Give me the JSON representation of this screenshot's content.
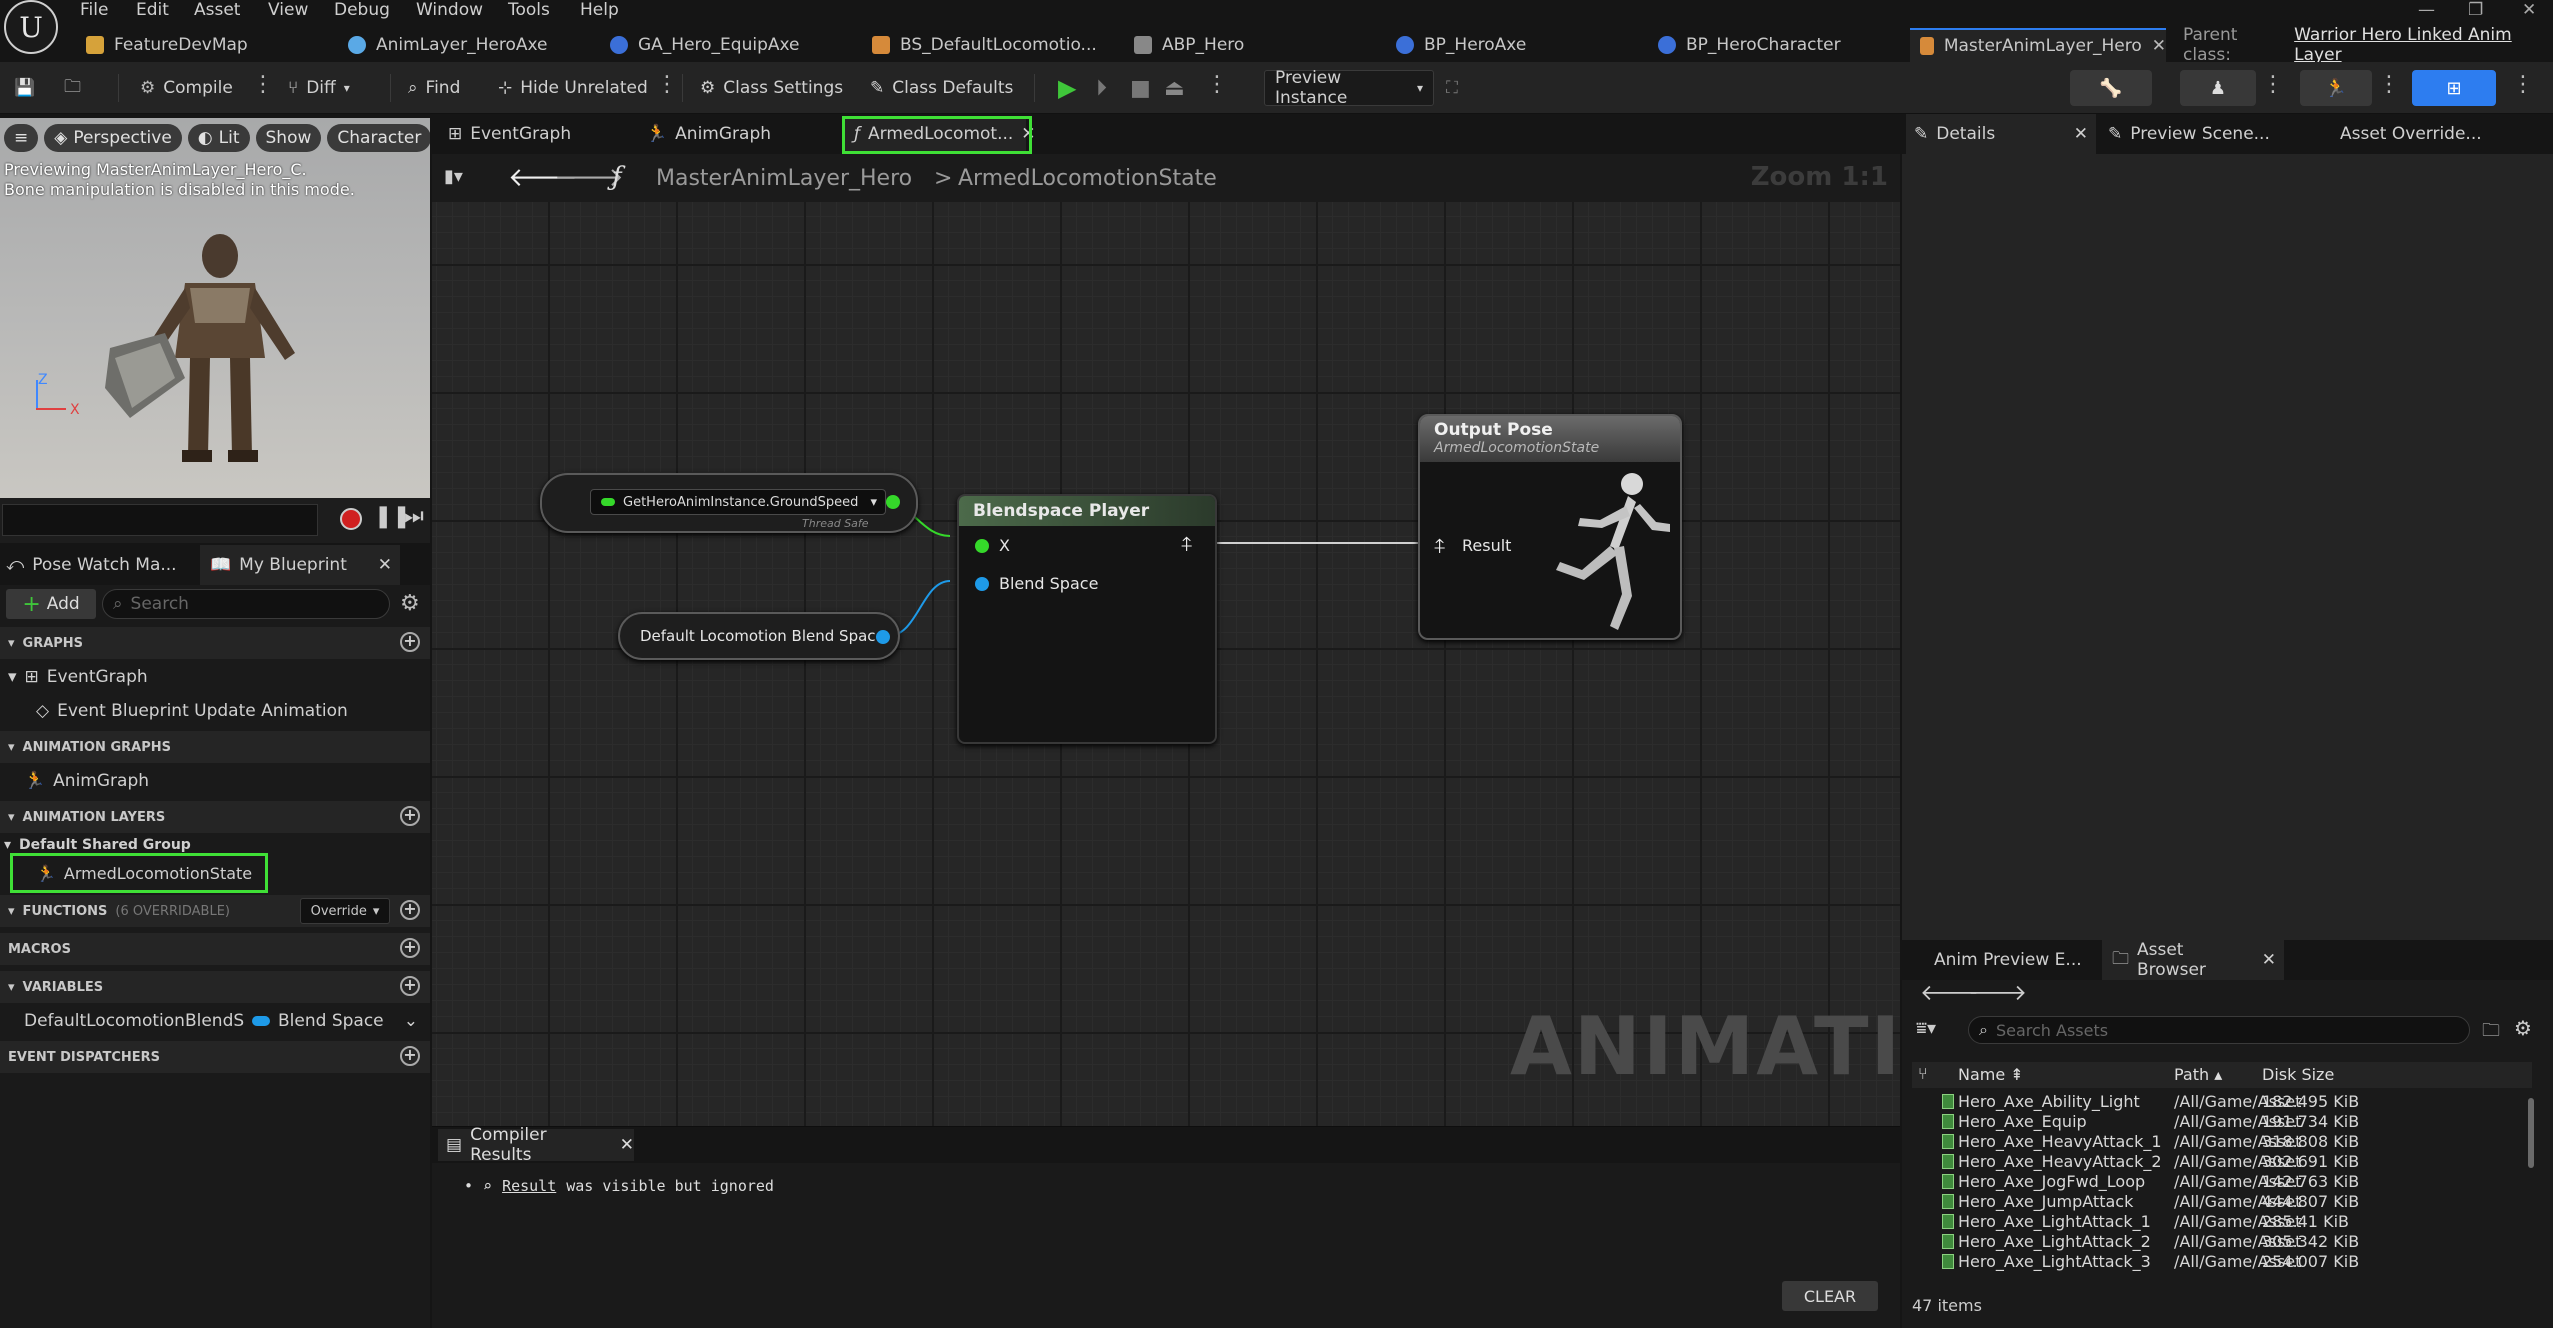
{
  "menu": {
    "items": [
      "File",
      "Edit",
      "Asset",
      "View",
      "Debug",
      "Window",
      "Tools",
      "Help"
    ]
  },
  "doc_tabs": [
    {
      "label": "FeatureDevMap",
      "color": "#d6a23a"
    },
    {
      "label": "AnimLayer_HeroAxe",
      "color": "#5aa9e6"
    },
    {
      "label": "GA_Hero_EquipAxe",
      "color": "#3b6fd8"
    },
    {
      "label": "BS_DefaultLocomotio...",
      "color": "#d68a3a"
    },
    {
      "label": "ABP_Hero",
      "color": "#d0d0d0"
    },
    {
      "label": "BP_HeroAxe",
      "color": "#3b6fd8"
    },
    {
      "label": "BP_HeroCharacter",
      "color": "#3b6fd8"
    },
    {
      "label": "MasterAnimLayer_Hero",
      "color": "#d68a3a"
    }
  ],
  "parent_class": {
    "label": "Parent class:",
    "value": "Warrior Hero Linked Anim Layer"
  },
  "toolbar": {
    "compile": "Compile",
    "diff": "Diff",
    "find": "Find",
    "hide_unrelated": "Hide Unrelated",
    "class_settings": "Class Settings",
    "class_defaults": "Class Defaults",
    "preview_instance": "Preview Instance"
  },
  "viewport": {
    "perspective": "Perspective",
    "lit": "Lit",
    "show": "Show",
    "character": "Character",
    "line1": "Previewing MasterAnimLayer_Hero_C.",
    "line2": "Bone manipulation is disabled in this mode.",
    "axis_z": "Z",
    "axis_x": "X"
  },
  "left_tabs": {
    "pose_watch": "Pose Watch Ma...",
    "my_blueprint": "My Blueprint"
  },
  "my_blueprint": {
    "add": "Add",
    "search_placeholder": "Search",
    "graphs": "GRAPHS",
    "event_graph": "EventGraph",
    "event_update": "Event Blueprint Update Animation",
    "animation_graphs": "ANIMATION GRAPHS",
    "anim_graph": "AnimGraph",
    "animation_layers": "ANIMATION LAYERS",
    "shared_group": "Default Shared Group",
    "layer_item": "ArmedLocomotionState",
    "functions": "FUNCTIONS",
    "functions_note": "(6 OVERRIDABLE)",
    "override": "Override",
    "macros": "MACROS",
    "variables": "VARIABLES",
    "var_name": "DefaultLocomotionBlendSpa",
    "var_type": "Blend Space",
    "event_dispatchers": "EVENT DISPATCHERS"
  },
  "graph_tabs": {
    "event_graph": "EventGraph",
    "anim_graph": "AnimGraph",
    "armed": "ArmedLocomot..."
  },
  "breadcrumb": {
    "root": "MasterAnimLayer_Hero",
    "sep": ">",
    "leaf": "ArmedLocomotionState",
    "zoom": "Zoom 1:1"
  },
  "nodes": {
    "getter": "GetHeroAnimInstance.GroundSpeed",
    "thread_safe": "Thread Safe",
    "default_bs": "Default Locomotion Blend Space",
    "bs_player": "Blendspace Player",
    "pin_x": "X",
    "pin_bs": "Blend Space",
    "output_pose": "Output Pose",
    "output_sub": "ArmedLocomotionState",
    "pin_result": "Result"
  },
  "watermark": "ANIMATION",
  "compiler": {
    "tab": "Compiler Results",
    "link": "Result",
    "msg": "was visible but ignored",
    "clear": "CLEAR"
  },
  "details": {
    "details": "Details",
    "preview_scene": "Preview Scene...",
    "asset_override": "Asset Override..."
  },
  "asset_browser": {
    "anim_preview": "Anim Preview E...",
    "tab": "Asset Browser",
    "search_placeholder": "Search Assets",
    "col_name": "Name",
    "col_path": "Path",
    "col_size": "Disk Size",
    "rows": [
      {
        "name": "Hero_Axe_Ability_Light",
        "path": "/All/Game/Asset",
        "size": "182.495 KiB"
      },
      {
        "name": "Hero_Axe_Equip",
        "path": "/All/Game/Asset",
        "size": "191.734 KiB"
      },
      {
        "name": "Hero_Axe_HeavyAttack_1",
        "path": "/All/Game/Asset",
        "size": "318.808 KiB"
      },
      {
        "name": "Hero_Axe_HeavyAttack_2",
        "path": "/All/Game/Asset",
        "size": "302.691 KiB"
      },
      {
        "name": "Hero_Axe_JogFwd_Loop",
        "path": "/All/Game/Asset",
        "size": "142.763 KiB"
      },
      {
        "name": "Hero_Axe_JumpAttack",
        "path": "/All/Game/Asset",
        "size": "444.807 KiB"
      },
      {
        "name": "Hero_Axe_LightAttack_1",
        "path": "/All/Game/Asset",
        "size": "285.41 KiB"
      },
      {
        "name": "Hero_Axe_LightAttack_2",
        "path": "/All/Game/Asset",
        "size": "305.342 KiB"
      },
      {
        "name": "Hero_Axe_LightAttack_3",
        "path": "/All/Game/Asset",
        "size": "254.007 KiB"
      }
    ],
    "count": "47 items"
  },
  "colors": {
    "highlight": "#3fe036",
    "accent": "#2d7df0",
    "float_pin": "#35d82a",
    "bs_pin": "#1e9ae8"
  }
}
